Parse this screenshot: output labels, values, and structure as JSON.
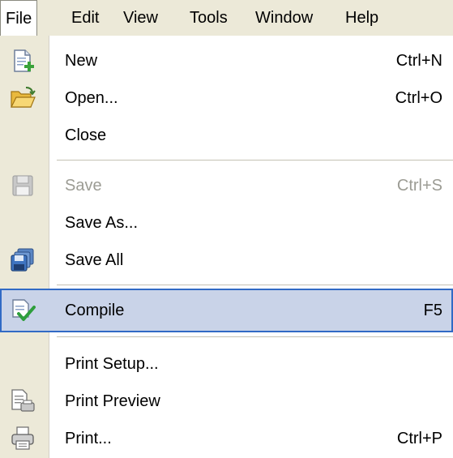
{
  "menubar": {
    "items": [
      "File",
      "Edit",
      "View",
      "Tools",
      "Window",
      "Help"
    ]
  },
  "file_menu": {
    "items": [
      {
        "label": "New",
        "shortcut": "Ctrl+N",
        "icon": "new-file-icon",
        "enabled": true
      },
      {
        "label": "Open...",
        "shortcut": "Ctrl+O",
        "icon": "open-folder-icon",
        "enabled": true
      },
      {
        "label": "Close",
        "shortcut": "",
        "icon": "",
        "enabled": true
      },
      {
        "label": "Save",
        "shortcut": "Ctrl+S",
        "icon": "save-disk-icon",
        "enabled": false
      },
      {
        "label": "Save As...",
        "shortcut": "",
        "icon": "",
        "enabled": true
      },
      {
        "label": "Save All",
        "shortcut": "",
        "icon": "save-all-icon",
        "enabled": true
      },
      {
        "label": "Compile",
        "shortcut": "F5",
        "icon": "compile-check-icon",
        "enabled": true,
        "selected": true
      },
      {
        "label": "Print Setup...",
        "shortcut": "",
        "icon": "",
        "enabled": true
      },
      {
        "label": "Print Preview",
        "shortcut": "",
        "icon": "print-preview-icon",
        "enabled": true
      },
      {
        "label": "Print...",
        "shortcut": "Ctrl+P",
        "icon": "printer-icon",
        "enabled": true
      }
    ]
  },
  "colors": {
    "menubar_bg": "#ece9d8",
    "gutter_bg": "#ece9d8",
    "highlight_bg": "#c9d3e8",
    "highlight_border": "#316ac5",
    "disabled_text": "#9c9c94"
  }
}
